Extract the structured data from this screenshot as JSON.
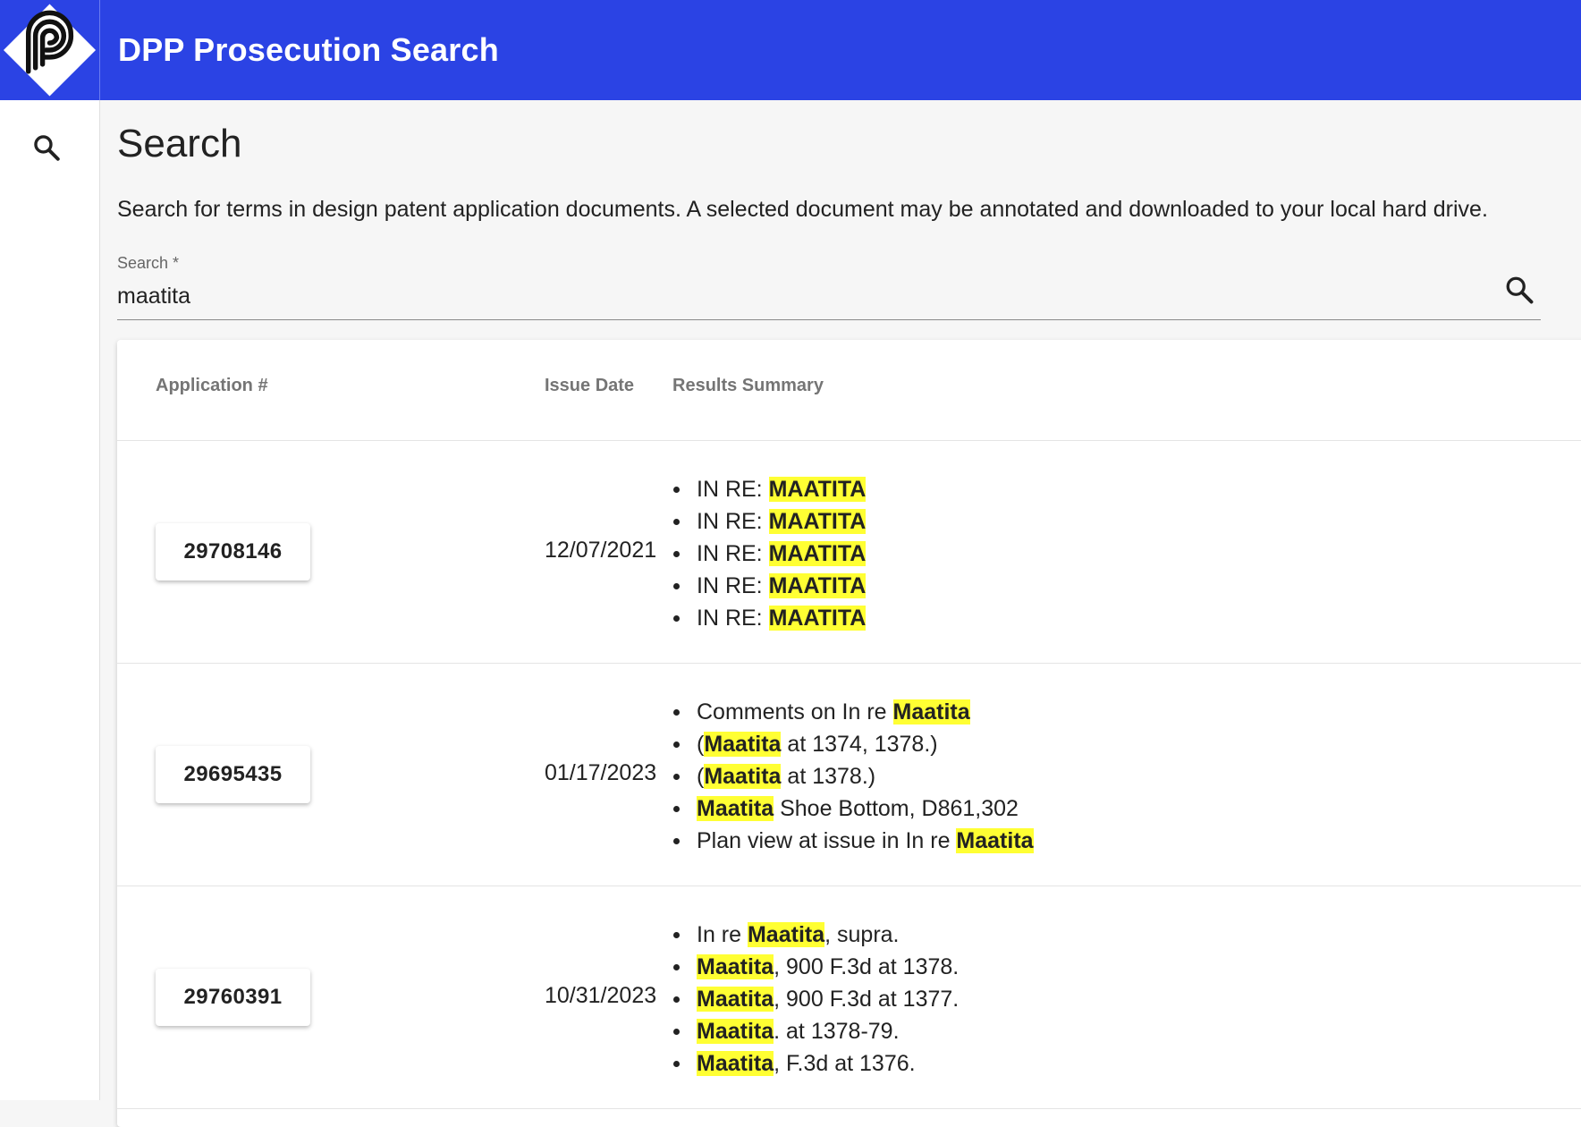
{
  "app": {
    "title": "DPP Prosecution Search",
    "brand_color": "#2b43e4",
    "logo_icon": "dpp-logo-icon"
  },
  "sidebar": {
    "items": [
      {
        "icon": "search-icon",
        "label": ""
      }
    ]
  },
  "page": {
    "title": "Search",
    "description": "Search for terms in design patent application documents. A selected document may be annotated and downloaded to your local hard drive."
  },
  "search": {
    "label": "Search *",
    "value": "maatita",
    "icon": "search-icon"
  },
  "table": {
    "columns": [
      "Application #",
      "Issue Date",
      "Results Summary"
    ],
    "highlight_color": "#ffff33",
    "rows": [
      {
        "application": "29708146",
        "issue_date": "12/07/2021",
        "summary": [
          [
            "IN RE: ",
            "MAATITA",
            ""
          ],
          [
            "IN RE: ",
            "MAATITA",
            ""
          ],
          [
            "IN RE: ",
            "MAATITA",
            ""
          ],
          [
            "IN RE: ",
            "MAATITA",
            ""
          ],
          [
            "IN RE: ",
            "MAATITA",
            ""
          ]
        ]
      },
      {
        "application": "29695435",
        "issue_date": "01/17/2023",
        "summary": [
          [
            "Comments on In re ",
            "Maatita",
            ""
          ],
          [
            "(",
            "Maatita",
            " at 1374, 1378.)"
          ],
          [
            "(",
            "Maatita",
            " at 1378.)"
          ],
          [
            "",
            "Maatita",
            " Shoe Bottom, D861,302"
          ],
          [
            "Plan view at issue in In re ",
            "Maatita",
            ""
          ]
        ]
      },
      {
        "application": "29760391",
        "issue_date": "10/31/2023",
        "summary": [
          [
            "In re ",
            "Maatita",
            ", supra."
          ],
          [
            "",
            "Maatita",
            ", 900 F.3d at 1378."
          ],
          [
            "",
            "Maatita",
            ", 900 F.3d at 1377."
          ],
          [
            "",
            "Maatita",
            ". at 1378-79."
          ],
          [
            "",
            "Maatita",
            ", F.3d at 1376."
          ]
        ]
      }
    ]
  }
}
